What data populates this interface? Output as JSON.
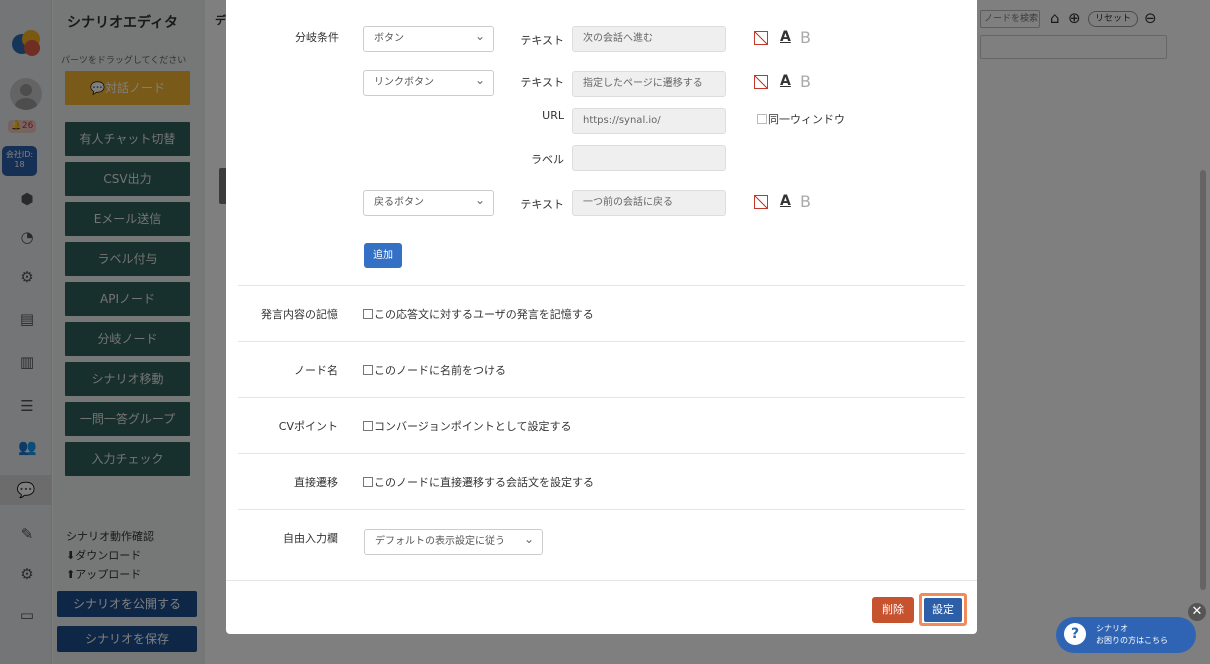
{
  "app": {
    "title": "シナリオエディタ",
    "drag_hint": "パーツをドラッグしてください"
  },
  "rail": {
    "notification_count": "26",
    "company_label": "会社ID:",
    "company_id": "18"
  },
  "sidebar": {
    "nodes": [
      "有人チャット切替",
      "CSV出力",
      "Eメール送信",
      "ラベル付与",
      "APIノード",
      "分岐ノード",
      "シナリオ移動",
      "一問一答グループ",
      "入力チェック"
    ],
    "dialog_node": "対話ノード",
    "links": [
      "シナリオ動作確認",
      "ダウンロード",
      "アップロード"
    ],
    "publish_button": "シナリオを公開する",
    "save_button": "シナリオを保存"
  },
  "canvas": {
    "tab_char": "デ",
    "search_placeholder": "ノードを検索",
    "reset_button": "リセット"
  },
  "modal": {
    "branch_label": "分岐条件",
    "branches": [
      {
        "type": "ボタン",
        "text_label": "テキスト",
        "text_value": "次の会話へ進む"
      },
      {
        "type": "リンクボタン",
        "text_label": "テキスト",
        "text_value": "指定したページに遷移する"
      },
      {
        "type": "戻るボタン",
        "text_label": "テキスト",
        "text_value": "一つ前の会話に戻る"
      }
    ],
    "url_label": "URL",
    "url_value": "https://synal.io/",
    "label_label": "ラベル",
    "label_value": "",
    "same_window": "同一ウィンドウ",
    "format_a": "A",
    "format_b": "B",
    "add_button": "追加",
    "rows": [
      {
        "label": "発言内容の記憶",
        "checkbox": "この応答文に対するユーザの発言を記憶する"
      },
      {
        "label": "ノード名",
        "checkbox": "このノードに名前をつける"
      },
      {
        "label": "CVポイント",
        "checkbox": "コンバージョンポイントとして設定する"
      },
      {
        "label": "直接遷移",
        "checkbox": "このノードに直接遷移する会話文を設定する"
      }
    ],
    "free_input_label": "自由入力欄",
    "free_input_value": "デフォルトの表示設定に従う",
    "delete_button": "削除",
    "set_button": "設定"
  },
  "help": {
    "line1": "シナリオ",
    "line2": "お困りの方はこちら"
  },
  "colors": {
    "node_green": "#2f5e5b",
    "node_orange": "#f2b531",
    "primary_blue": "#2c5fa8",
    "danger": "#c6522e"
  }
}
